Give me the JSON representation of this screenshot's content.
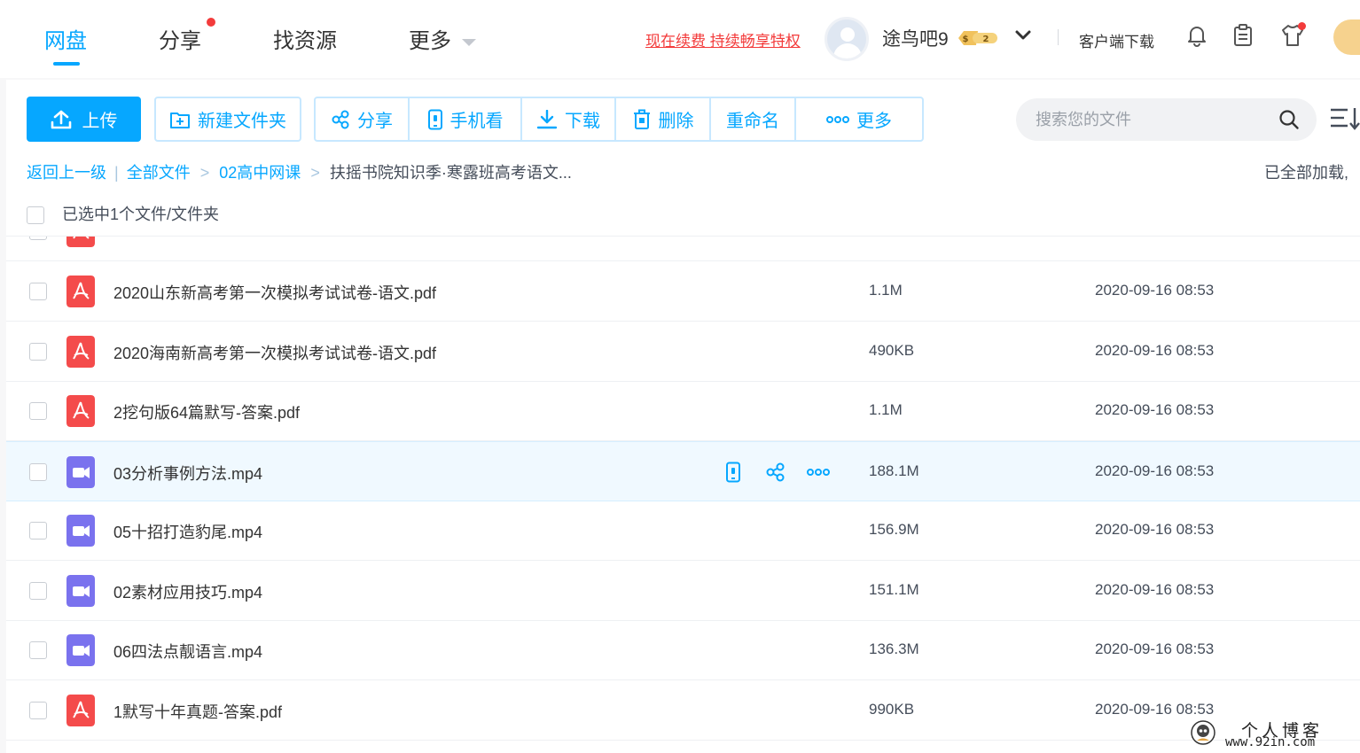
{
  "nav": {
    "tabs": [
      {
        "label": "网盘",
        "active": true
      },
      {
        "label": "分享",
        "badge": "red-dot"
      },
      {
        "label": "找资源"
      },
      {
        "label": "更多",
        "dropdown": true
      }
    ],
    "renew_link": "现在续费 持续畅享特权",
    "username": "途鸟吧9",
    "vip_level": "2",
    "client_download": "客户端下载",
    "icons": [
      "bell-icon",
      "clipboard-icon",
      "tshirt-icon",
      "coin-icon"
    ]
  },
  "toolbar": {
    "upload": "上传",
    "new_folder": "新建文件夹",
    "actions": [
      {
        "label": "分享",
        "icon": "share-icon"
      },
      {
        "label": "手机看",
        "icon": "phone-icon"
      },
      {
        "label": "下载",
        "icon": "download-icon"
      },
      {
        "label": "删除",
        "icon": "trash-icon"
      },
      {
        "label": "重命名",
        "icon": ""
      },
      {
        "label": "更多",
        "icon": "more-icon"
      }
    ]
  },
  "search": {
    "placeholder": "搜索您的文件"
  },
  "breadcrumb": {
    "back": "返回上一级",
    "items": [
      "全部文件",
      "02高中网课"
    ],
    "current": "扶摇书院知识季·寒露班高考语文..."
  },
  "loaded_note": "已全部加载,",
  "selection": {
    "text": "已选中1个文件/文件夹"
  },
  "files": [
    {
      "name": "2020山东新高考第一次模拟考试试卷-语文.pdf",
      "size": "1.1M",
      "date": "2020-09-16 08:53",
      "type": "pdf"
    },
    {
      "name": "2020海南新高考第一次模拟考试试卷-语文.pdf",
      "size": "490KB",
      "date": "2020-09-16 08:53",
      "type": "pdf"
    },
    {
      "name": "2挖句版64篇默写-答案.pdf",
      "size": "1.1M",
      "date": "2020-09-16 08:53",
      "type": "pdf"
    },
    {
      "name": "03分析事例方法.mp4",
      "size": "188.1M",
      "date": "2020-09-16 08:53",
      "type": "video"
    },
    {
      "name": "05十招打造豹尾.mp4",
      "size": "156.9M",
      "date": "2020-09-16 08:53",
      "type": "video"
    },
    {
      "name": "02素材应用技巧.mp4",
      "size": "151.1M",
      "date": "2020-09-16 08:53",
      "type": "video"
    },
    {
      "name": "06四法点靓语言.mp4",
      "size": "136.3M",
      "date": "2020-09-16 08:53",
      "type": "video"
    },
    {
      "name": "1默写十年真题-答案.pdf",
      "size": "990KB",
      "date": "2020-09-16 08:53",
      "type": "pdf"
    }
  ],
  "watermark": {
    "title": "个人博客",
    "url": "www.92in.com"
  },
  "colors": {
    "accent": "#06a7ff",
    "pdf": "#f44b4b",
    "video": "#7a72ee",
    "alert": "#f33b3b"
  }
}
